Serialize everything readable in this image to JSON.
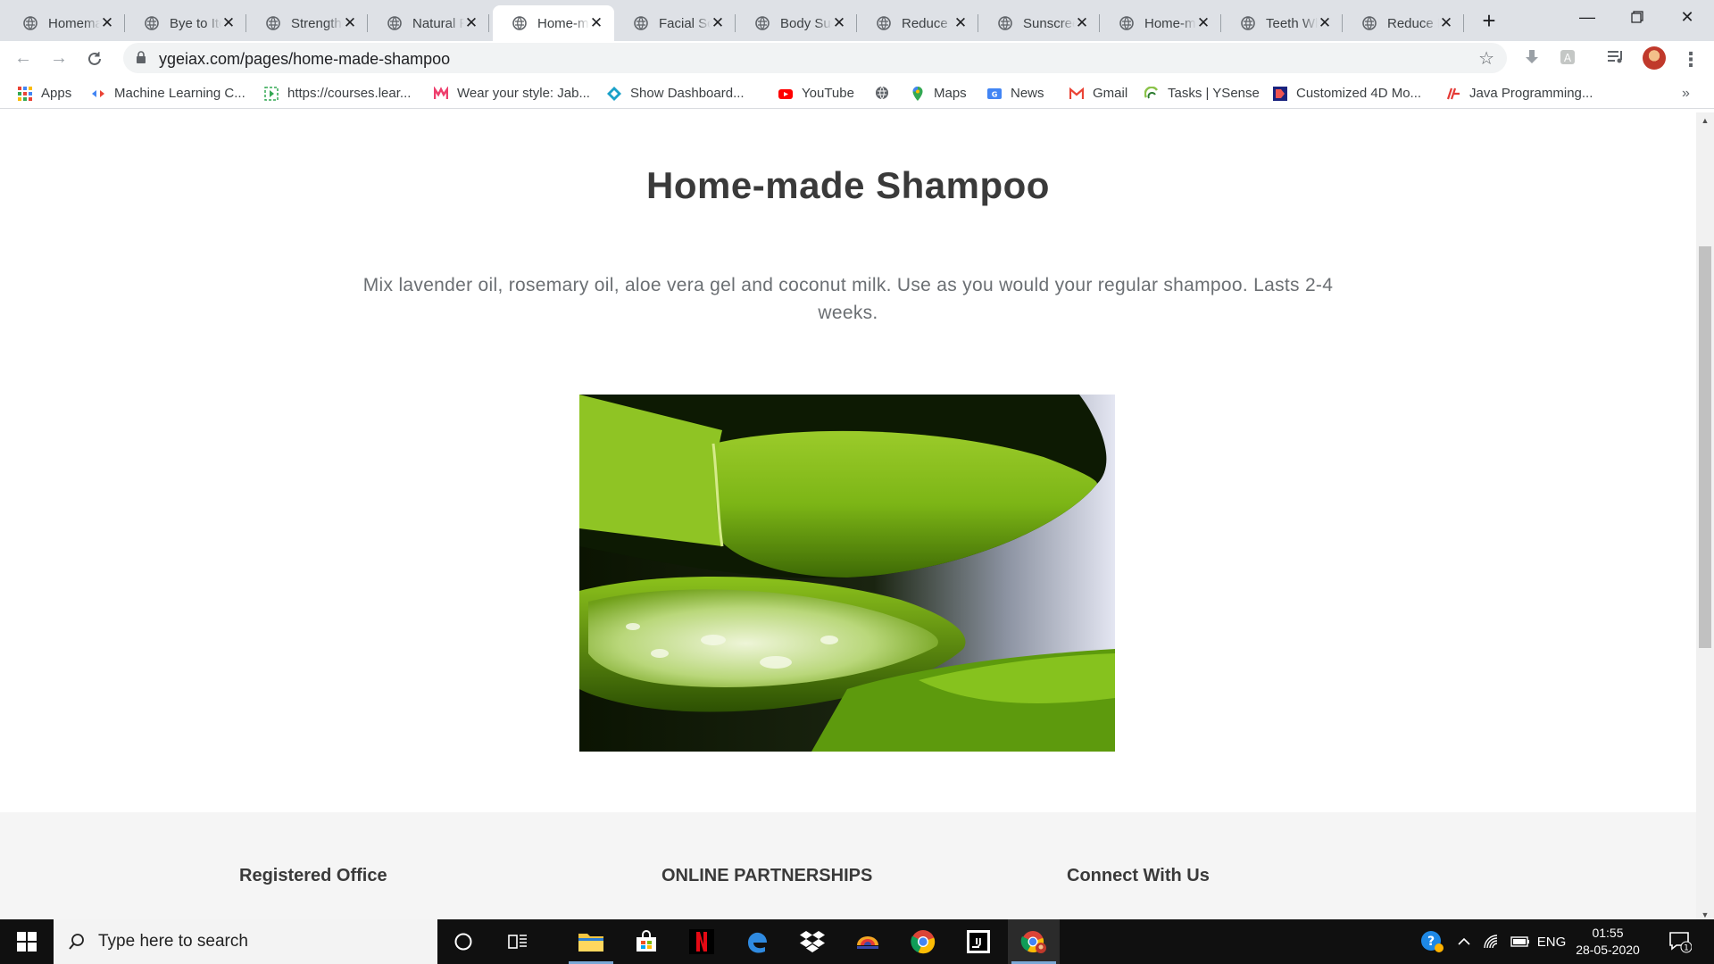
{
  "browser": {
    "tabs": [
      {
        "title": "Homemade Face Mask"
      },
      {
        "title": "Bye to Itchy Scalp"
      },
      {
        "title": "Strengthen Nails"
      },
      {
        "title": "Natural Remedies"
      },
      {
        "title": "Home-made Shampoo",
        "active": true
      },
      {
        "title": "Facial Scrub"
      },
      {
        "title": "Body Sugar Scrub"
      },
      {
        "title": "Reduce Scars"
      },
      {
        "title": "Sunscreen"
      },
      {
        "title": "Home-made Toothpaste"
      },
      {
        "title": "Teeth Whitening"
      },
      {
        "title": "Reduce Pimples"
      }
    ],
    "url": "ygeiax.com/pages/home-made-shampoo",
    "bookmarks": [
      {
        "label": "Apps",
        "icon": "apps-grid-icon"
      },
      {
        "label": "Machine Learning C...",
        "icon": "ml-icon"
      },
      {
        "label": "https://courses.lear...",
        "icon": "courses-icon"
      },
      {
        "label": "Wear your style: Jab...",
        "icon": "myntra-icon"
      },
      {
        "label": "Show Dashboard...",
        "icon": "dashboard-icon"
      },
      {
        "label": "YouTube",
        "icon": "youtube-icon"
      },
      {
        "label": "",
        "icon": "globe-icon"
      },
      {
        "label": "Maps",
        "icon": "maps-icon"
      },
      {
        "label": "News",
        "icon": "news-icon"
      },
      {
        "label": "Gmail",
        "icon": "gmail-icon"
      },
      {
        "label": "Tasks | YSense",
        "icon": "ysense-icon"
      },
      {
        "label": "Customized 4D Mo...",
        "icon": "4d-icon"
      },
      {
        "label": "Java Programming...",
        "icon": "java-icon"
      }
    ]
  },
  "page": {
    "title": "Home-made Shampoo",
    "description": "Mix lavender oil, rosemary oil, aloe vera gel and coconut milk. Use as you would your regular shampoo. Lasts 2-4 weeks.",
    "image_subject": "aloe-vera-slices",
    "footer": {
      "col1": "Registered Office",
      "col2": "ONLINE PARTNERSHIPS",
      "col3": "Connect With Us"
    }
  },
  "taskbar": {
    "search_placeholder": "Type here to search",
    "language": "ENG",
    "time": "01:55",
    "date": "28-05-2020",
    "notification_count": "1"
  },
  "colors": {
    "tabstrip": "#dee1e6",
    "title_text": "#3a3a3a",
    "body_text": "#6b6f73",
    "footer_bg": "#f5f5f5",
    "taskbar": "#101010"
  }
}
